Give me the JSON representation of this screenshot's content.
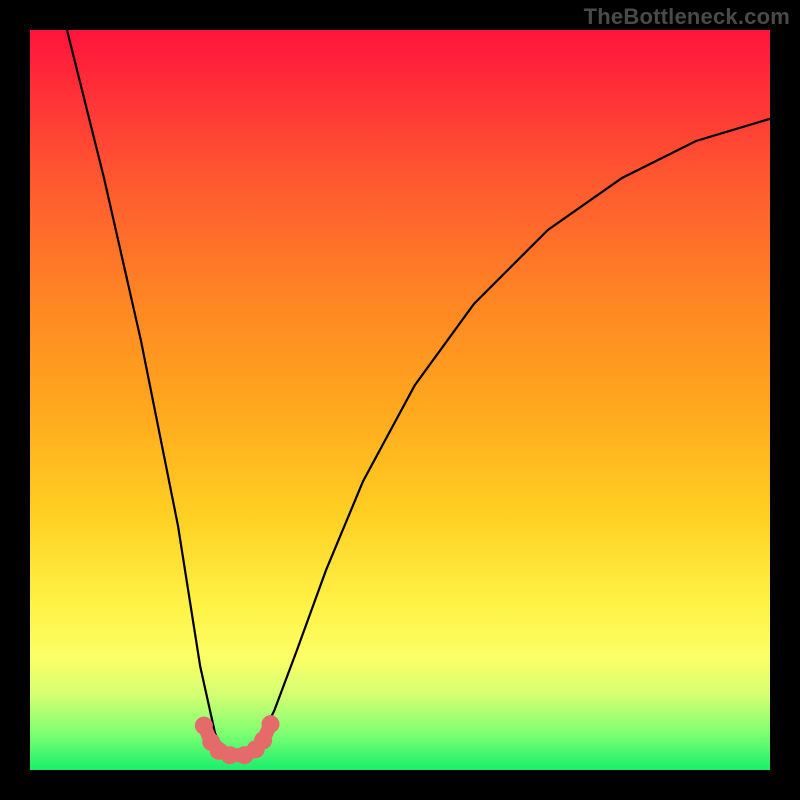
{
  "watermark": "TheBottleneck.com",
  "chart_data": {
    "type": "line",
    "title": "",
    "xlabel": "",
    "ylabel": "",
    "xlim": [
      0,
      100
    ],
    "ylim": [
      0,
      100
    ],
    "notes": "V-shaped bottleneck curve on a vertical red-to-green gradient. Minimum around x≈28. No numeric axis ticks are shown; x/y values below are read as percentages of the plot area.",
    "series": [
      {
        "name": "bottleneck-curve",
        "x": [
          5,
          10,
          15,
          20,
          23,
          25,
          26,
          27,
          28,
          29,
          30,
          31,
          33,
          36,
          40,
          45,
          52,
          60,
          70,
          80,
          90,
          100
        ],
        "y": [
          100,
          80,
          58,
          33,
          14,
          5,
          3,
          2,
          2,
          2,
          3,
          4,
          8,
          16,
          27,
          39,
          52,
          63,
          73,
          80,
          85,
          88
        ]
      },
      {
        "name": "trough-marker",
        "x": [
          23.5,
          24.5,
          25.5,
          27.0,
          29.0,
          30.5,
          31.5,
          32.5
        ],
        "y": [
          6.0,
          3.8,
          2.6,
          2.0,
          2.0,
          2.8,
          4.0,
          6.2
        ]
      }
    ]
  },
  "colors": {
    "curve_stroke": "#000000",
    "marker_stroke": "#e56a6a",
    "marker_fill": "#e56a6a"
  }
}
